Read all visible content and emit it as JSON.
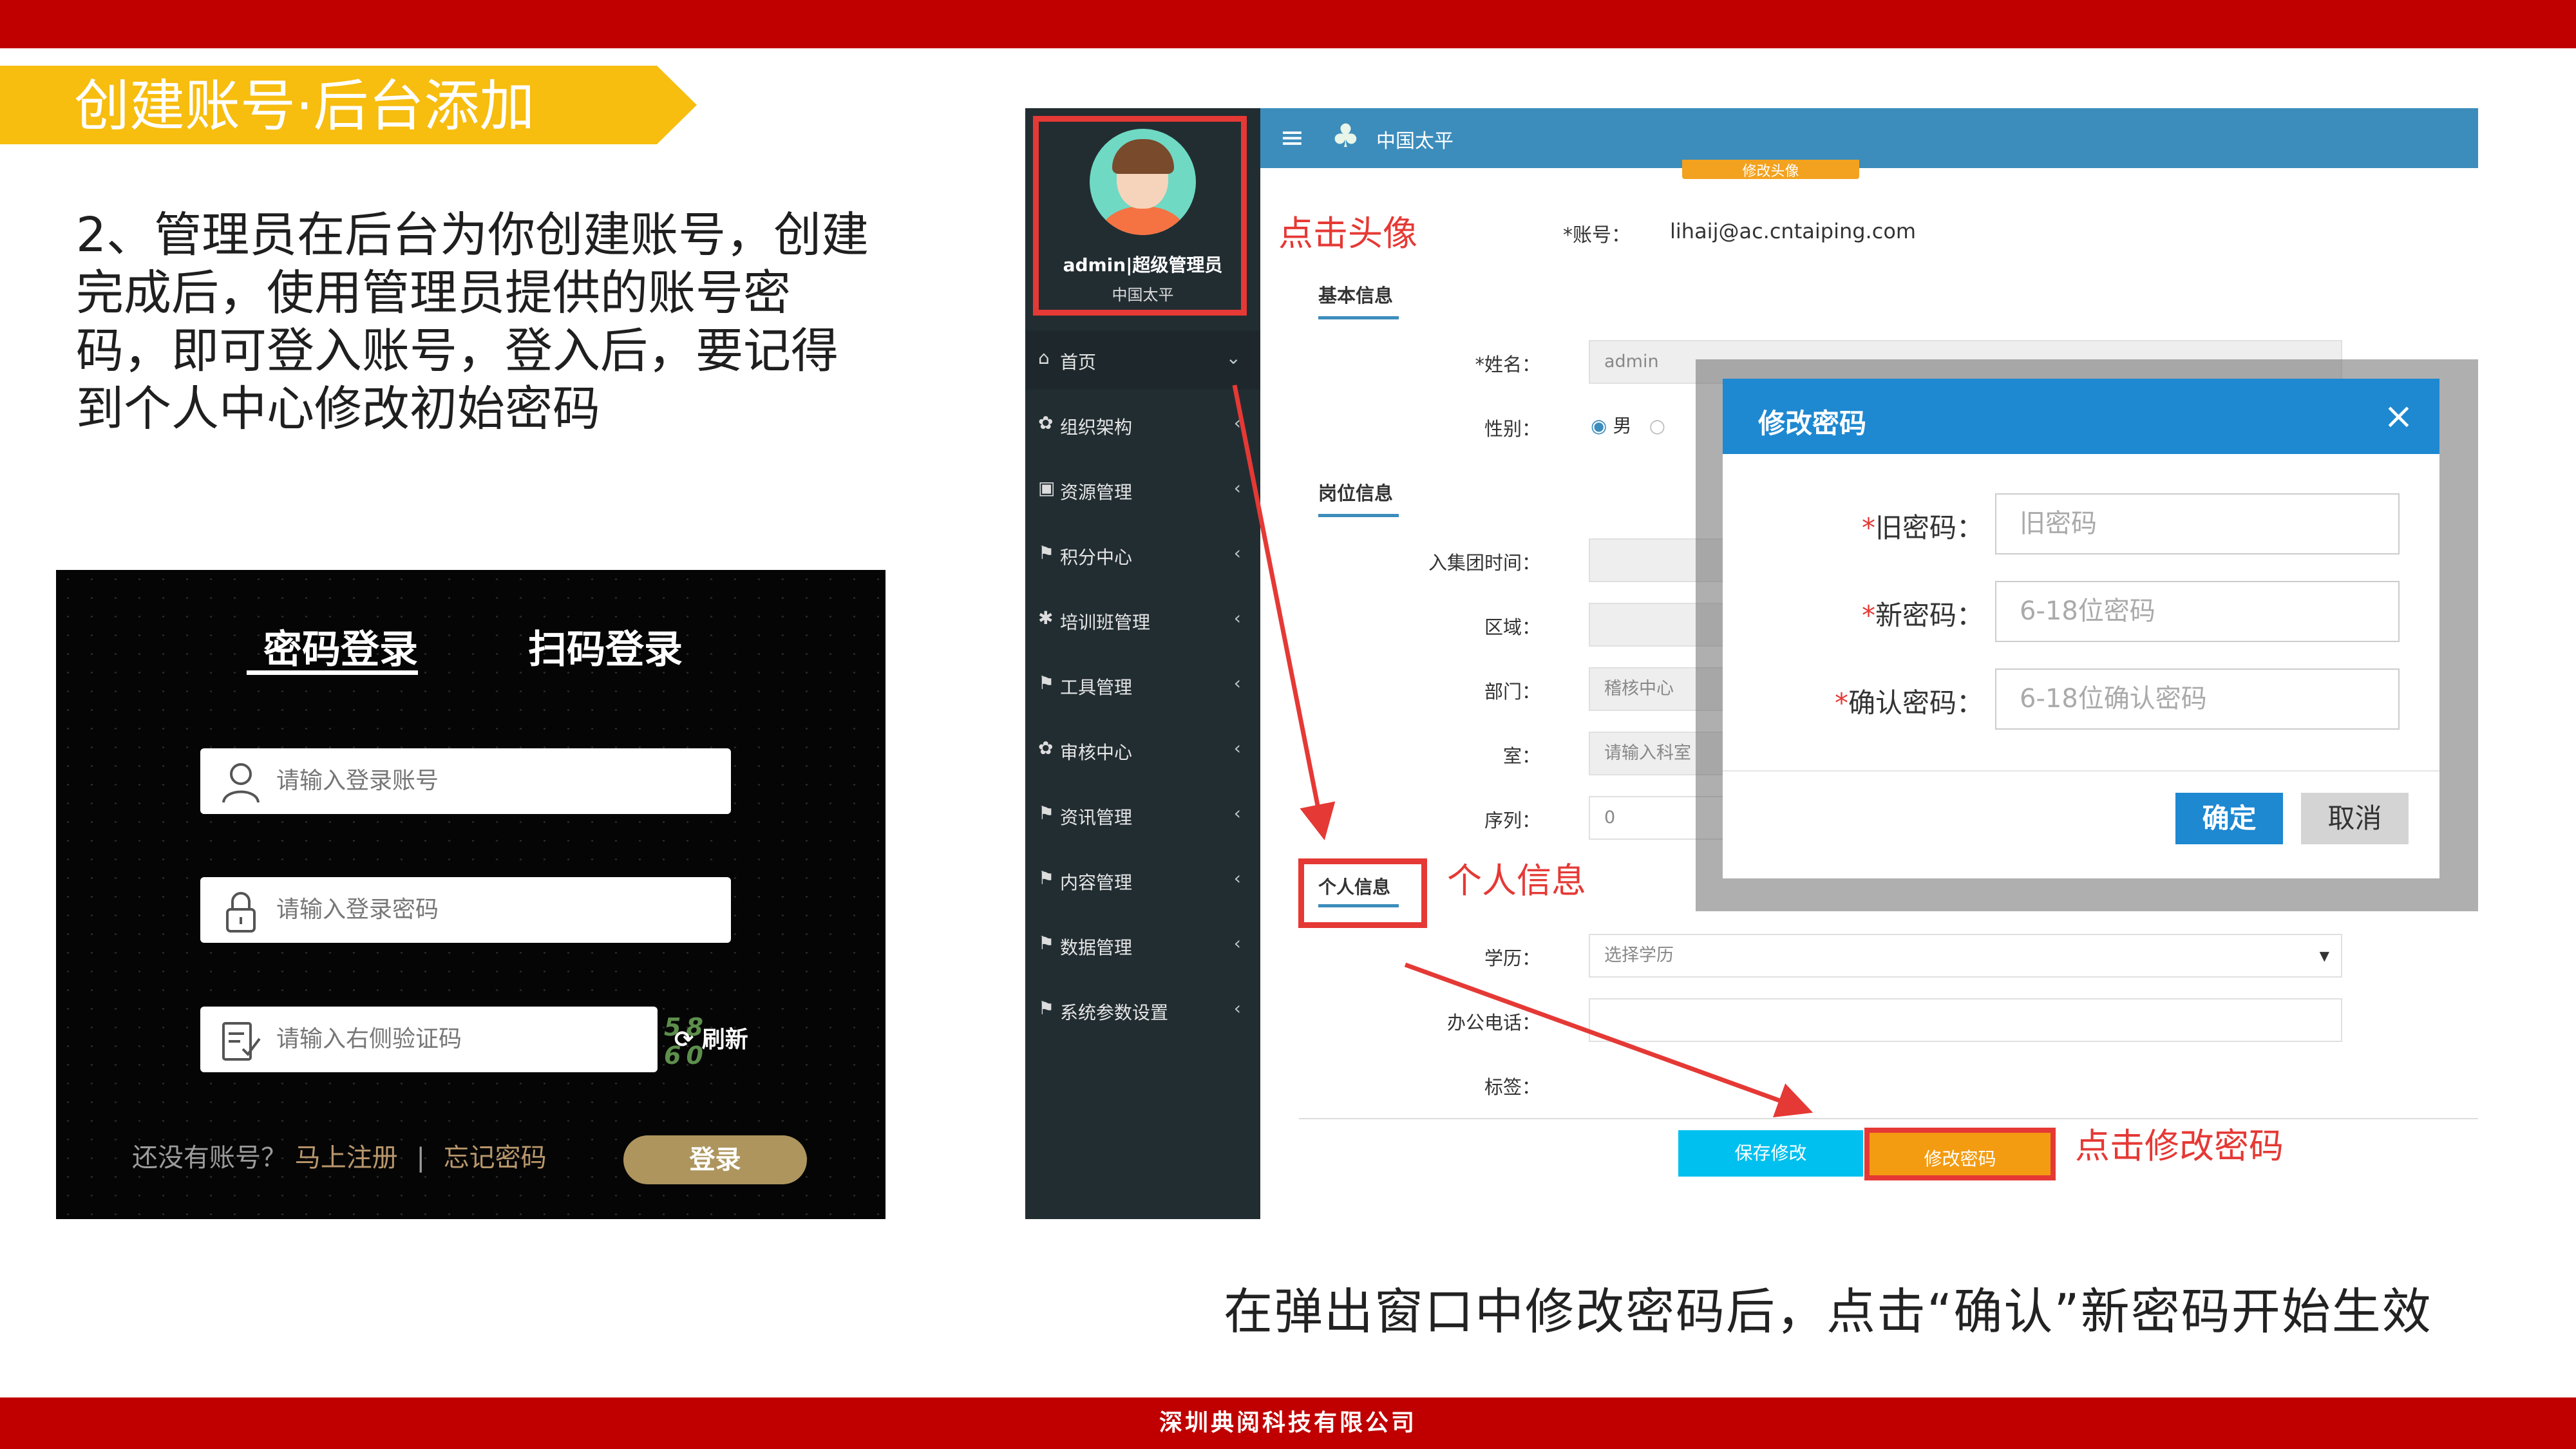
{
  "slide": {
    "title": "创建账号·后台添加",
    "description": "2、管理员在后台为你创建账号，创建完成后，使用管理员提供的账号密码，即可登入账号，登入后，要记得到个人中心修改初始密码",
    "caption": "在弹出窗口中修改密码后，点击“确认”新密码开始生效",
    "footer": "深圳典阅科技有限公司",
    "colors": {
      "accent_red": "#c00000",
      "banner_yellow": "#f7bd0f",
      "annotation_red": "#e53935"
    }
  },
  "login": {
    "tab_password": "密码登录",
    "tab_qrcode": "扫码登录",
    "account_placeholder": "请输入登录账号",
    "password_placeholder": "请输入登录密码",
    "captcha_placeholder": "请输入右侧验证码",
    "captcha_text": "58 60",
    "refresh": "刷新",
    "no_account": "还没有账号？",
    "register": "马上注册",
    "separator": "|",
    "forgot": "忘记密码",
    "login_button": "登录"
  },
  "admin": {
    "brand": "中国太平",
    "profile_name": "admin|超级管理员",
    "profile_org": "中国太平",
    "menu": [
      {
        "label": "首页",
        "icon": "home-icon",
        "glyph": "⌂",
        "arrow": "⌄"
      },
      {
        "label": "组织架构",
        "icon": "sitemap-icon",
        "glyph": "✿",
        "arrow": "‹"
      },
      {
        "label": "资源管理",
        "icon": "calendar-icon",
        "glyph": "▣",
        "arrow": "‹"
      },
      {
        "label": "积分中心",
        "icon": "flag-icon",
        "glyph": "⚑",
        "arrow": "‹"
      },
      {
        "label": "培训班管理",
        "icon": "gear-icon",
        "glyph": "✱",
        "arrow": "‹"
      },
      {
        "label": "工具管理",
        "icon": "flag-icon",
        "glyph": "⚑",
        "arrow": "‹"
      },
      {
        "label": "审核中心",
        "icon": "sitemap-icon",
        "glyph": "✿",
        "arrow": "‹"
      },
      {
        "label": "资讯管理",
        "icon": "flag-icon",
        "glyph": "⚑",
        "arrow": "‹"
      },
      {
        "label": "内容管理",
        "icon": "flag-icon",
        "glyph": "⚑",
        "arrow": "‹"
      },
      {
        "label": "数据管理",
        "icon": "flag-icon",
        "glyph": "⚑",
        "arrow": "‹"
      },
      {
        "label": "系统参数设置",
        "icon": "flag-icon",
        "glyph": "⚑",
        "arrow": "‹"
      }
    ],
    "photo_button": "修改头像",
    "note_avatar": "点击头像",
    "account_label": "*账号：",
    "account_value": "lihaij@ac.cntaiping.com",
    "section_basic": "基本信息",
    "name_label": "*姓名：",
    "name_value": "admin",
    "gender_label": "性别：",
    "gender_male": "男",
    "section_post": "岗位信息",
    "join_label": "入集团时间：",
    "region_label": "区域：",
    "dept_label": "部门：",
    "dept_value": "稽核中心",
    "room_label": "室：",
    "room_placeholder": "请输入科室",
    "seq_label": "序列：",
    "seq_value": "0",
    "section_personal": "个人信息",
    "note_personal": "个人信息",
    "edu_label": "学历：",
    "edu_placeholder": "选择学历",
    "phone_label": "办公电话：",
    "tag_label": "标签：",
    "save_button": "保存修改",
    "change_password_button": "修改密码",
    "note_change_password": "点击修改密码"
  },
  "modal": {
    "title": "修改密码",
    "old_label": "旧密码：",
    "old_placeholder": "旧密码",
    "new_label": "新密码：",
    "new_placeholder": "6-18位密码",
    "confirm_label": "确认密码：",
    "confirm_placeholder": "6-18位确认密码",
    "required_mark": "*",
    "ok_button": "确定",
    "cancel_button": "取消"
  }
}
